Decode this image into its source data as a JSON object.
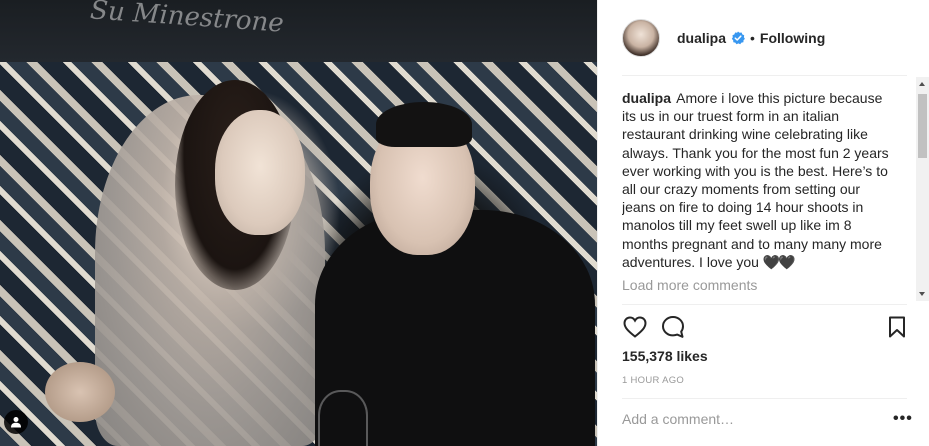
{
  "post": {
    "username": "dualipa",
    "verified_icon": "verified-badge-icon",
    "separator": "•",
    "follow_status": "Following",
    "wall_writing": "Su Minestrone",
    "caption_user": "dualipa",
    "caption_text": "Amore i love this picture because its us in our truest form in an italian restaurant drinking wine celebrating like always. Thank you for the most fun 2 years ever working with you is the best. Here’s to all our crazy moments from setting our jeans on fire to doing 14 hour shoots in manolos till my feet swell up like im 8 months pregnant and to many many more adventures. I love you",
    "caption_emoji": "🖤🖤",
    "load_more": "Load more comments",
    "likes": "155,378 likes",
    "time_ago": "1 HOUR AGO",
    "comment_placeholder": "Add a comment…",
    "more_options": "•••"
  },
  "icons": {
    "like": "heart-icon",
    "comment": "speech-bubble-icon",
    "save": "bookmark-icon",
    "tag": "person-tag-icon"
  },
  "colors": {
    "verified_blue": "#3897f0",
    "text": "#262626",
    "muted": "#999999",
    "divider": "#efefef"
  }
}
